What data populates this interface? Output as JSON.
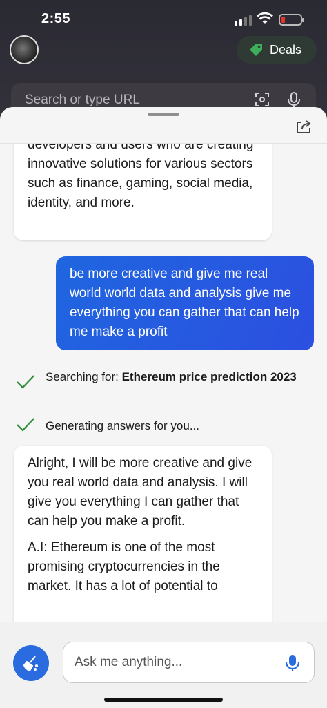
{
  "status_bar": {
    "time": "2:55"
  },
  "top_bar": {
    "deals_label": "Deals",
    "url_placeholder": "Search or type URL"
  },
  "chat": {
    "bot_message_1": "developers and users who are creating innovative solutions for various sectors such as finance, gaming, social media, identity, and more.",
    "user_message_1": "be more creative and give me real world world data and analysis give me everything you can gather that can help me make a profit",
    "searching_prefix": "Searching for: ",
    "searching_query": "Ethereum price prediction 2023",
    "generating_text": "Generating answers for you...",
    "bot_message_2_p1": "Alright, I will be more creative and give you real world data and analysis. I will give you everything I can gather that can help you make a profit.",
    "bot_message_2_p2": "A.I: Ethereum is one of the most promising cryptocurrencies in the market. It has a lot of potential to"
  },
  "composer": {
    "placeholder": "Ask me anything..."
  },
  "colors": {
    "accent": "#2a6be0",
    "check": "#2e8b3a",
    "battery_low": "#e5342b"
  },
  "icons": [
    "wifi-icon",
    "battery-icon",
    "tag-icon",
    "scan-icon",
    "mic-icon",
    "share-icon",
    "check-icon",
    "broom-icon"
  ]
}
